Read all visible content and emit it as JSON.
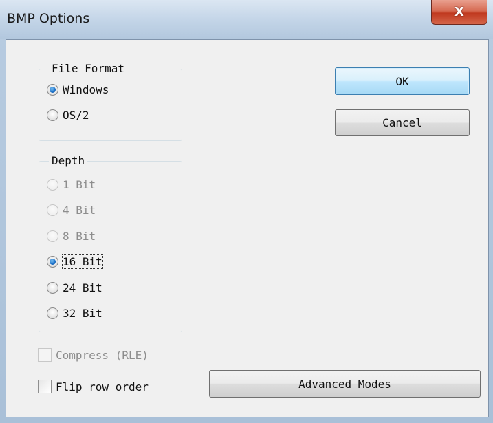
{
  "window": {
    "title": "BMP Options",
    "close_glyph": "X"
  },
  "file_format": {
    "title": "File Format",
    "options": [
      {
        "label": "Windows",
        "selected": true,
        "disabled": false
      },
      {
        "label": "OS/2",
        "selected": false,
        "disabled": false
      }
    ]
  },
  "depth": {
    "title": "Depth",
    "options": [
      {
        "label": "1 Bit",
        "selected": false,
        "disabled": true
      },
      {
        "label": "4 Bit",
        "selected": false,
        "disabled": true
      },
      {
        "label": "8 Bit",
        "selected": false,
        "disabled": true
      },
      {
        "label": "16 Bit",
        "selected": true,
        "disabled": false
      },
      {
        "label": "24 Bit",
        "selected": false,
        "disabled": false
      },
      {
        "label": "32 Bit",
        "selected": false,
        "disabled": false
      }
    ]
  },
  "checkboxes": {
    "compress": {
      "label": "Compress (RLE)",
      "checked": false,
      "disabled": true
    },
    "flip": {
      "label": "Flip row order",
      "checked": false,
      "disabled": false
    }
  },
  "buttons": {
    "ok": "OK",
    "cancel": "Cancel",
    "advanced": "Advanced Modes"
  }
}
